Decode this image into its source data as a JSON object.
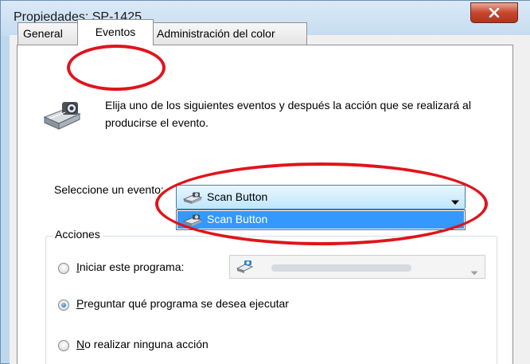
{
  "window": {
    "title": "Propiedades: SP-1425"
  },
  "tabs": [
    {
      "label": "General",
      "active": false
    },
    {
      "label": "Eventos",
      "active": true
    },
    {
      "label": "Administración del color",
      "active": false
    }
  ],
  "events": {
    "description": "Elija uno de los siguientes eventos y después la acción que se realizará al producirse el evento.",
    "select_label": "Seleccione un evento:",
    "selected": "Scan Button",
    "options": [
      "Scan Button"
    ]
  },
  "actions": {
    "group_label": "Acciones",
    "options": [
      {
        "label": "Iniciar este programa:",
        "checked": false
      },
      {
        "label": "Preguntar qué programa se desea ejecutar",
        "checked": true
      },
      {
        "label": "No realizar ninguna acción",
        "checked": false
      }
    ]
  },
  "colors": {
    "highlight": "#e0141c",
    "selection": "#3399ff",
    "close_button": "#c7462c"
  },
  "icons": [
    "close-icon",
    "scanner-icon",
    "chevron-down-icon",
    "program-icon"
  ]
}
